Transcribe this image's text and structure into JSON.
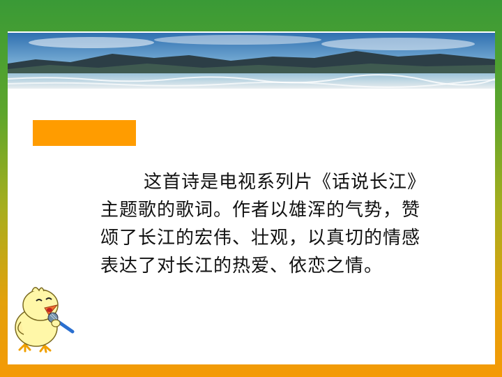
{
  "slide": {
    "paragraph_lines": [
      "这首诗是电视系列片《话说长江》",
      "主题歌的歌词。作者以雄浑的气势，赞",
      "颂了长江的宏伟、壮观，以真切的情感",
      "表达了对长江的热爱、依恋之情。"
    ]
  },
  "decor": {
    "banner": "landscape-banner-image",
    "label_bar": "orange-label-bar",
    "mascot": "singing-chick-icon"
  },
  "colors": {
    "accent_orange": "#ff9c00",
    "frame_green": "#3a9a36",
    "frame_orange": "#f49a06"
  }
}
